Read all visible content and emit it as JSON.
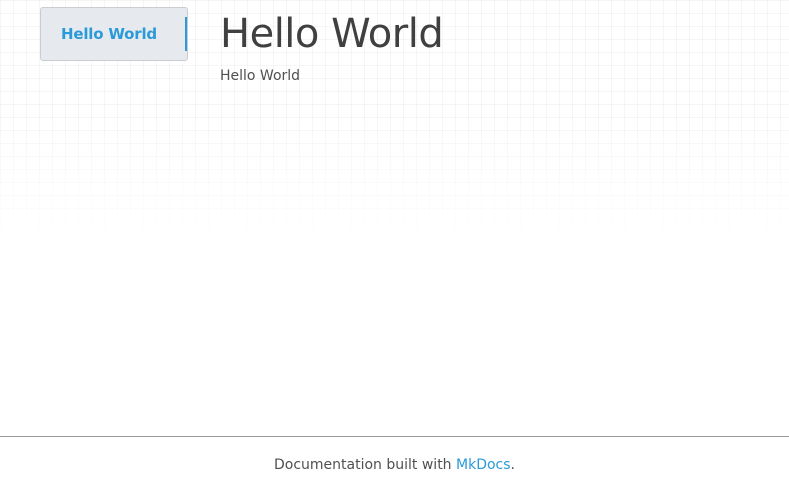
{
  "sidebar": {
    "items": [
      {
        "label": "Hello World",
        "active": true
      }
    ]
  },
  "main": {
    "title": "Hello World",
    "body": "Hello World"
  },
  "footer": {
    "prefix": "Documentation built with ",
    "link_label": "MkDocs",
    "suffix": "."
  },
  "colors": {
    "accent": "#2a9ad8",
    "text": "#404040",
    "sidebar_bg": "#e6eaee"
  }
}
